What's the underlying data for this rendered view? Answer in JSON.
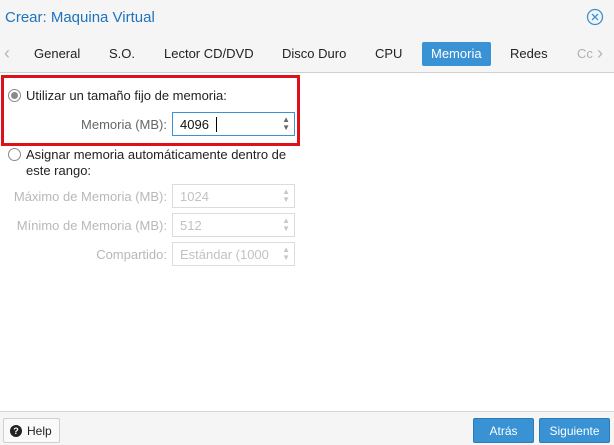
{
  "window": {
    "title": "Crear: Maquina Virtual"
  },
  "icons": {
    "close": "close-circle-icon",
    "prev": "chevron-left-icon",
    "next": "chevron-right-icon",
    "help": "question-circle-icon",
    "spin": "spinner-arrows-icon"
  },
  "tabs": [
    "General",
    "S.O.",
    "Lector CD/DVD",
    "Disco Duro",
    "CPU",
    "Memoria",
    "Redes",
    "Cc"
  ],
  "active_tab": "Memoria",
  "fixed": {
    "radio_label": "Utilizar un tamaño fijo de memoria:",
    "memory_label": "Memoria (MB):",
    "memory_value": "4096"
  },
  "auto": {
    "radio_label_line1": "Asignar memoria automáticamente dentro de",
    "radio_label_line2": "este rango:",
    "max_label": "Máximo de Memoria (MB):",
    "max_value": "1024",
    "min_label": "Mínimo de Memoria (MB):",
    "min_value": "512",
    "shares_label": "Compartido:",
    "shares_value": "Estándar (1000"
  },
  "footer": {
    "help": "Help",
    "back": "Atrás",
    "next": "Siguiente"
  },
  "colors": {
    "accent": "#3892d4",
    "highlight": "#e0101a"
  }
}
